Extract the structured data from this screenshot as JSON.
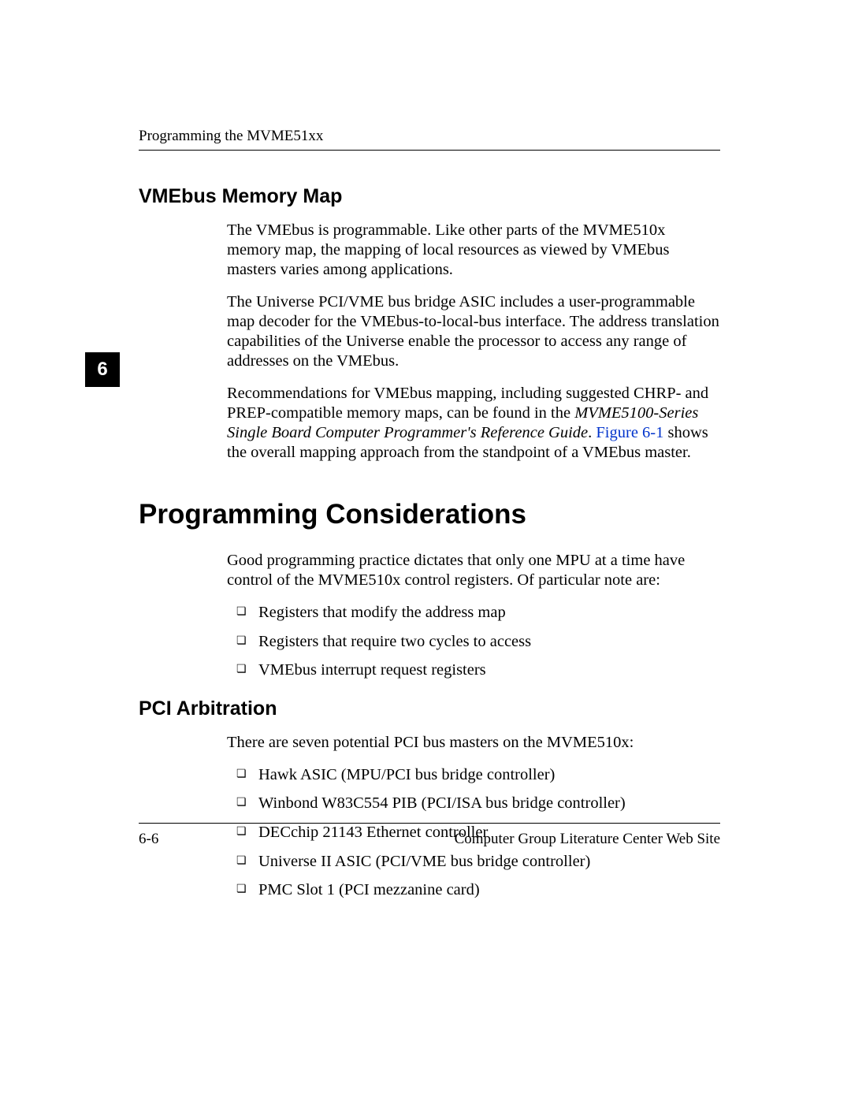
{
  "header": {
    "running_title": "Programming the MVME51xx"
  },
  "chapter_tab": "6",
  "sections": {
    "vmebus": {
      "title": "VMEbus Memory Map",
      "p1": "The VMEbus is programmable. Like other parts of the MVME510x memory map, the mapping of local resources as viewed by VMEbus masters varies among applications.",
      "p2": "The Universe PCI/VME bus bridge ASIC includes a user-programmable map decoder for the VMEbus-to-local-bus interface.  The address translation capabilities of the Universe enable the processor to access any range of addresses on the VMEbus.",
      "p3_pre": "Recommendations for VMEbus mapping, including suggested CHRP- and PREP-compatible memory maps, can be found in the ",
      "p3_italic": "MVME5100-Series Single Board Computer Programmer's Reference Guide",
      "p3_mid": ". ",
      "p3_link": "Figure 6-1",
      "p3_post": " shows the overall mapping approach from the standpoint of a VMEbus master."
    },
    "prog": {
      "title": "Programming Considerations",
      "p1": "Good programming practice dictates that only one MPU at a time have control of the MVME510x control registers. Of particular note are:",
      "bullets": [
        "Registers that modify the address map",
        "Registers that require two cycles to access",
        "VMEbus interrupt request registers"
      ]
    },
    "pci": {
      "title": "PCI Arbitration",
      "p1": "There are seven potential PCI bus masters on the MVME510x:",
      "bullets": [
        "Hawk ASIC (MPU/PCI bus bridge controller)",
        "Winbond W83C554 PIB (PCI/ISA bus bridge controller)",
        "DECchip 21143 Ethernet controller",
        "Universe II ASIC (PCI/VME bus bridge controller)",
        "PMC Slot 1 (PCI mezzanine card)"
      ]
    }
  },
  "footer": {
    "page_number": "6-6",
    "site": "Computer Group Literature Center Web Site"
  }
}
